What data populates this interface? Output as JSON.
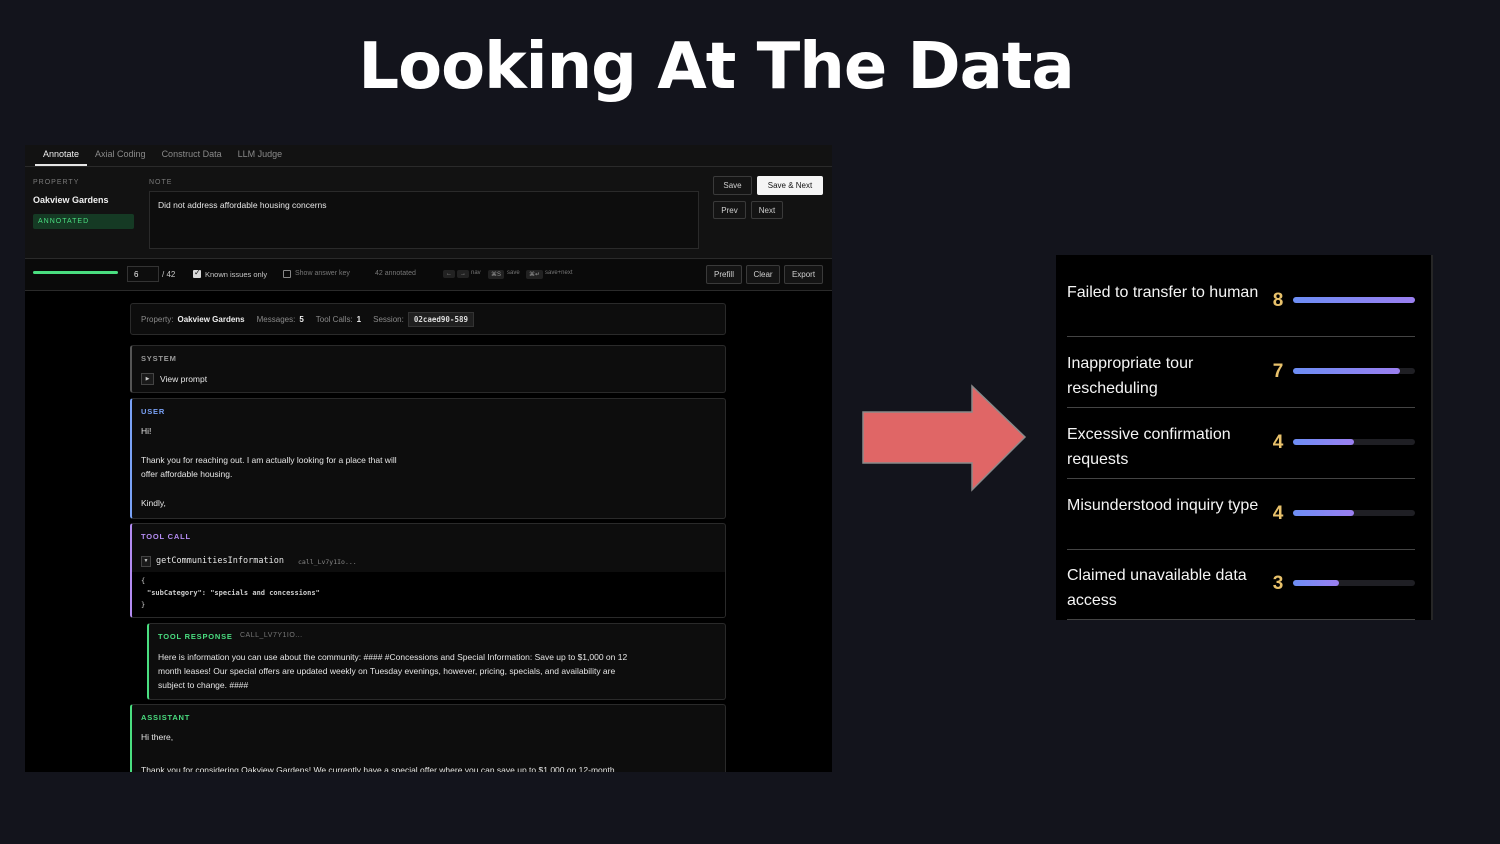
{
  "slide_title": "Looking At The Data",
  "app": {
    "tabs": [
      {
        "label": "Annotate",
        "active": true
      },
      {
        "label": "Axial Coding",
        "active": false
      },
      {
        "label": "Construct Data",
        "active": false
      },
      {
        "label": "LLM Judge",
        "active": false
      }
    ],
    "property_label": "PROPERTY",
    "property_name": "Oakview Gardens",
    "status_badge": "ANNOTATED",
    "note_label": "NOTE",
    "note_text": "Did not address affordable housing concerns",
    "buttons": {
      "save": "Save",
      "save_next": "Save & Next",
      "prev": "Prev",
      "next": "Next",
      "prefill": "Prefill",
      "clear": "Clear",
      "export": "Export"
    },
    "toolbar": {
      "progress": 0.14,
      "current_index": "6",
      "total": "/ 42",
      "known_issues_label": "Known issues only",
      "known_issues_checked": true,
      "show_answer_key_label": "Show answer key",
      "show_answer_key_checked": false,
      "annotated_count": "42 annotated",
      "hint_left": "←",
      "hint_right": "→",
      "hint_nav": "nav",
      "hint_save_key": "⌘S",
      "hint_save": "save",
      "hint_savenext_key": "⌘↵",
      "hint_savenext": "save+next"
    },
    "meta": {
      "property_label": "Property:",
      "property_value": "Oakview Gardens",
      "messages_label": "Messages:",
      "messages_value": "5",
      "tool_calls_label": "Tool Calls:",
      "tool_calls_value": "1",
      "session_label": "Session:",
      "session_value": "02caed90-589"
    },
    "messages": {
      "system_role": "SYSTEM",
      "system_toggle": "View prompt",
      "user_role": "USER",
      "user_line1": "Hi!",
      "user_line2": "Thank you for reaching out. I am actually looking for a place that will",
      "user_line3": "offer affordable housing.",
      "user_line4": "Kindly,",
      "tool_call_role": "TOOL CALL",
      "tool_call_name": "getCommunitiesInformation",
      "tool_call_id": "call_Lv7y1Io...",
      "tool_call_open": "{",
      "tool_call_arg": "\"subCategory\": \"specials and concessions\"",
      "tool_call_close": "}",
      "tool_response_role": "TOOL RESPONSE",
      "tool_response_id": "CALL_LV7Y1IO...",
      "tool_response_line1": "Here is information you can use about the community: #### #Concessions and Special Information: Save up to $1,000 on 12",
      "tool_response_line2": "month leases! Our special offers are updated weekly on Tuesday evenings, however, pricing, specials, and availability are",
      "tool_response_line3": "subject to change. ####",
      "assistant_role": "ASSISTANT",
      "assistant_line1": "Hi there,",
      "assistant_line2": "Thank you for considering Oakview Gardens! We currently have a special offer where you can save up to $1,000 on 12-month"
    }
  },
  "failure_modes": {
    "max": 8,
    "items": [
      {
        "label": "Failed to transfer to human",
        "count": 8
      },
      {
        "label": "Inappropriate tour rescheduling",
        "count": 7
      },
      {
        "label": "Excessive confirmation requests",
        "count": 4
      },
      {
        "label": "Misunderstood inquiry type",
        "count": 4
      },
      {
        "label": "Claimed unavailable data access",
        "count": 3
      }
    ]
  },
  "colors": {
    "arrow": "#e06666",
    "count": "#e8c16b",
    "bar_start": "#6d8ef5",
    "bar_end": "#9b7ff0",
    "user_role": "#7aa2f7",
    "tool_call_role": "#b48cf2",
    "tool_response_role": "#4ade80",
    "assistant_role": "#4ade80"
  }
}
